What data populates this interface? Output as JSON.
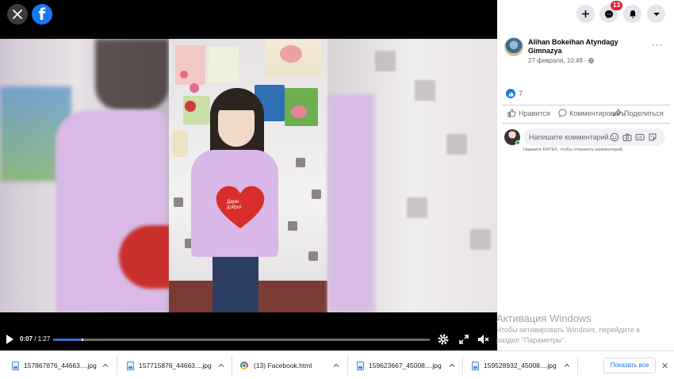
{
  "colors": {
    "facebook_blue": "#1877f2",
    "notification_red": "#e41e3f",
    "progress_buffer": "#3a6fd8"
  },
  "viewer": {
    "close_icon": "close-icon",
    "logo_icon": "facebook-logo-icon",
    "logo_letter": "f",
    "heart_text_line1": "Дарю",
    "heart_text_line2": "добро!"
  },
  "player": {
    "current_time": "0:07",
    "duration": "/ 1:27",
    "progress_fraction": 0.0805,
    "buffer_fraction": 0.075
  },
  "top_right": {
    "notification_count": "13",
    "icons": [
      "plus-icon",
      "messenger-icon",
      "notifications-icon",
      "account-menu-icon"
    ]
  },
  "post": {
    "author": "Alihan Bokeihan Atyndagy Gimnazya",
    "timestamp": "27 февраля, 10:48 · ",
    "more": "···",
    "reaction_count": "7",
    "actions": {
      "like": "Нравится",
      "comment": "Комментировать",
      "share": "Поделиться"
    },
    "comment_placeholder": "Напишите комментарий...",
    "comment_hint": "Нажмите ENTER, чтобы отправить комментарий."
  },
  "windows_activation": {
    "title": "Активация Windows",
    "line1": "Чтобы активировать Windows, перейдите в",
    "line2": "раздел \"Параметры\"."
  },
  "downloads": {
    "items": [
      {
        "name": "157867876_44663....jpg",
        "type": "image"
      },
      {
        "name": "157715876_44663....jpg",
        "type": "image"
      },
      {
        "name": "(13) Facebook.html",
        "type": "chrome"
      },
      {
        "name": "159623667_45008....jpg",
        "type": "image"
      },
      {
        "name": "159528932_45008....jpg",
        "type": "image"
      }
    ],
    "show_all": "Показать все",
    "close": "✕"
  }
}
